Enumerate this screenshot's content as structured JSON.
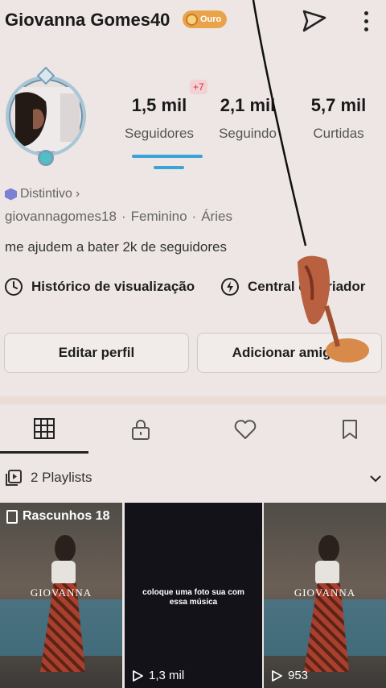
{
  "header": {
    "username": "Giovanna Gomes40",
    "badge_label": "Ouro"
  },
  "stats": {
    "followers_value": "1,5 mil",
    "followers_label": "Seguidores",
    "followers_new": "+7",
    "following_value": "2,1 mil",
    "following_label": "Seguindo",
    "likes_value": "5,7 mil",
    "likes_label": "Curtidas"
  },
  "profile": {
    "distintivo": "Distintivo",
    "handle": "giovannagomes18",
    "gender": "Feminino",
    "sign": "Áries",
    "bio": "me ajudem a bater 2k de seguidores"
  },
  "actions": {
    "history": "Histórico de visualização",
    "creator": "Central do criador"
  },
  "buttons": {
    "edit": "Editar perfil",
    "add": "Adicionar amigos"
  },
  "playlists": {
    "label": "2 Playlists"
  },
  "videos": [
    {
      "overlay": "Rascunhos 18",
      "watermark": "GIOVANNA",
      "views": ""
    },
    {
      "caption": "coloque uma foto sua com essa música",
      "views": "1,3 mil"
    },
    {
      "watermark": "GIOVANNA",
      "views": "953"
    }
  ],
  "colors": {
    "background": "#ede6e4",
    "accent": "#3aa3d8",
    "badge": "#e9a34a",
    "new_followers": "#e0233b"
  }
}
